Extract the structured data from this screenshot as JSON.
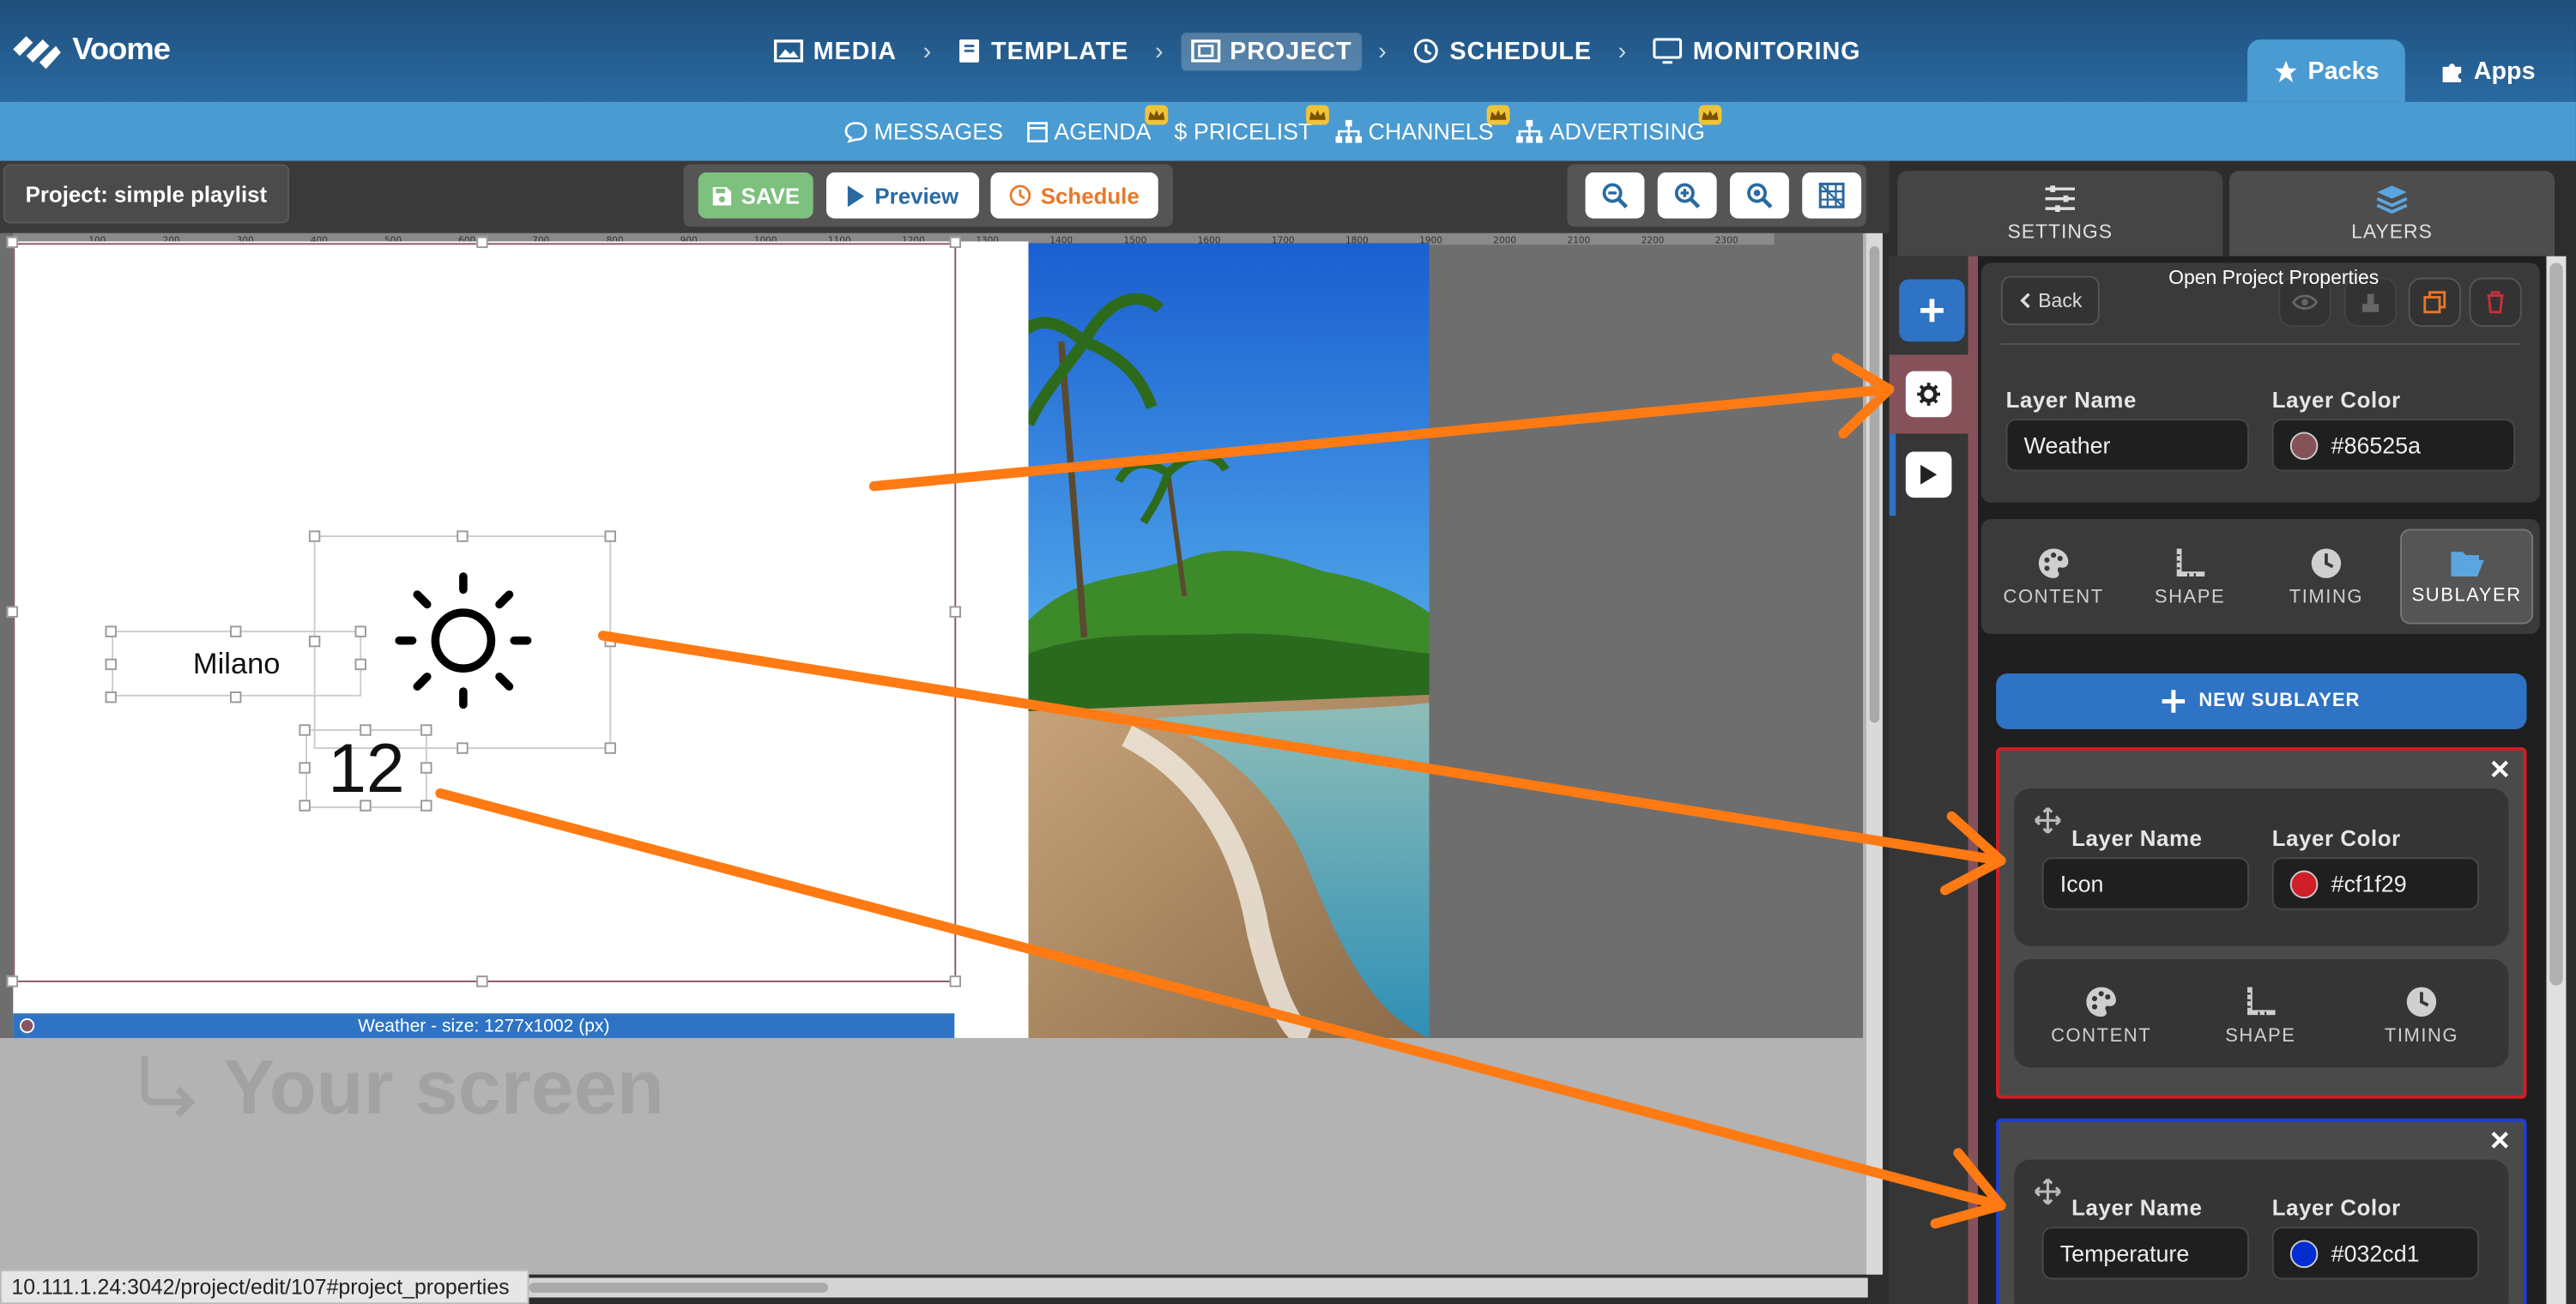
{
  "app": {
    "brand": "Voome"
  },
  "nav": {
    "items": [
      {
        "label": "MEDIA",
        "icon": "image-icon"
      },
      {
        "label": "TEMPLATE",
        "icon": "book-icon"
      },
      {
        "label": "PROJECT",
        "icon": "project-icon",
        "active": true
      },
      {
        "label": "SCHEDULE",
        "icon": "clock-icon"
      },
      {
        "label": "MONITORING",
        "icon": "monitor-icon"
      }
    ],
    "packs": "Packs",
    "apps": "Apps"
  },
  "subnav": {
    "items": [
      {
        "label": "MESSAGES",
        "icon": "chat-icon",
        "premium": false
      },
      {
        "label": "AGENDA",
        "icon": "calendar-icon",
        "premium": true
      },
      {
        "label": "PRICELIST",
        "icon": "dollar-icon",
        "premium": true
      },
      {
        "label": "CHANNELS",
        "icon": "sitemap-icon",
        "premium": true
      },
      {
        "label": "ADVERTISING",
        "icon": "sitemap-icon",
        "premium": true
      }
    ]
  },
  "toolbar": {
    "project_title": "Project: simple playlist",
    "save": "SAVE",
    "preview": "Preview",
    "schedule": "Schedule"
  },
  "canvas": {
    "city": "Milano",
    "temperature": "12",
    "layer_label": "Weather - size: 1277x1002 (px)",
    "placeholder": "Your screen",
    "ruler_ticks": [
      "100",
      "200",
      "300",
      "400",
      "500",
      "600",
      "700",
      "800",
      "900",
      "1000",
      "1100",
      "1200",
      "1300",
      "1400",
      "1500",
      "1600",
      "1700",
      "1800",
      "1900",
      "2000",
      "2100",
      "2200",
      "2300"
    ]
  },
  "status": {
    "url": "10.111.1.24:3042/project/edit/107#project_properties"
  },
  "panel": {
    "tabs": [
      {
        "label": "SETTINGS",
        "icon": "sliders-icon"
      },
      {
        "label": "LAYERS",
        "icon": "layers-icon"
      }
    ],
    "tooltip": "Open Project Properties",
    "back": "Back",
    "layer_name_label": "Layer Name",
    "layer_color_label": "Layer Color",
    "layer_name": "Weather",
    "layer_color": "#86525a",
    "content_tabs": [
      {
        "label": "CONTENT",
        "icon": "palette-icon"
      },
      {
        "label": "SHAPE",
        "icon": "ruler-icon"
      },
      {
        "label": "TIMING",
        "icon": "clock-icon"
      },
      {
        "label": "SUBLAYER",
        "icon": "folder-open-icon",
        "active": true
      }
    ],
    "new_sublayer": "NEW SUBLAYER",
    "sublayers": [
      {
        "name": "Icon",
        "color": "#cf1f29",
        "tabs": [
          "CONTENT",
          "SHAPE",
          "TIMING"
        ]
      },
      {
        "name": "Temperature",
        "color": "#032cd1"
      }
    ]
  },
  "colors": {
    "accent": "#4a9bd1",
    "nav_dark": "#1f4f7c",
    "arrow": "#ff7a12"
  }
}
